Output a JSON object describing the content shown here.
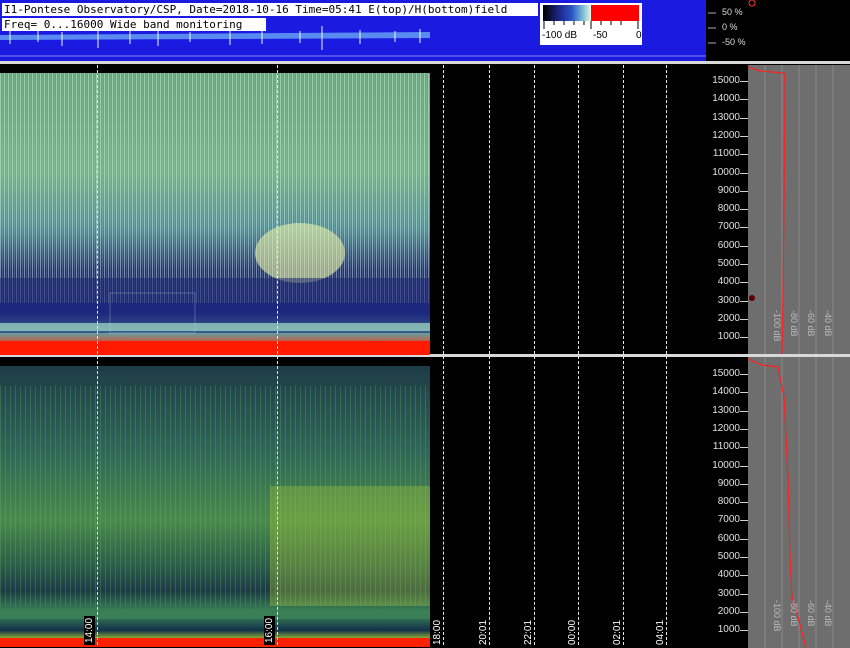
{
  "header": {
    "title": "I1-Pontese Observatory/CSP, Date=2018-10-16 Time=05:41 E(top)/H(bottom)field",
    "freq": "Freq= 0...16000 Wide band monitoring"
  },
  "legend": {
    "ticks": [
      "-100 dB",
      "-50",
      "0"
    ],
    "colors": [
      "#000000",
      "#1e2a8f",
      "#2a55c6",
      "#7fc1d8",
      "#e8f7e2",
      "#ffffff",
      "#ff0000"
    ]
  },
  "percent_axis": [
    "50 %",
    "0 %",
    "-50 %"
  ],
  "freq_axis": [
    "15000",
    "14000",
    "13000",
    "12000",
    "11000",
    "10000",
    "9000",
    "8000",
    "7000",
    "6000",
    "5000",
    "4000",
    "3000",
    "2000",
    "1000"
  ],
  "time_axis": [
    "14:00",
    "16:00",
    "18:00",
    "20:01",
    "22:01",
    "00:00",
    "02:01",
    "04:01"
  ],
  "db_labels": [
    "-100 dB",
    "-80 dB",
    "-60 dB",
    "-40 dB",
    "-20 dB"
  ],
  "colors": {
    "header_bg": "#1a1ae0",
    "panel_gray": "#6e6e6e",
    "curve": "#ff2020"
  }
}
